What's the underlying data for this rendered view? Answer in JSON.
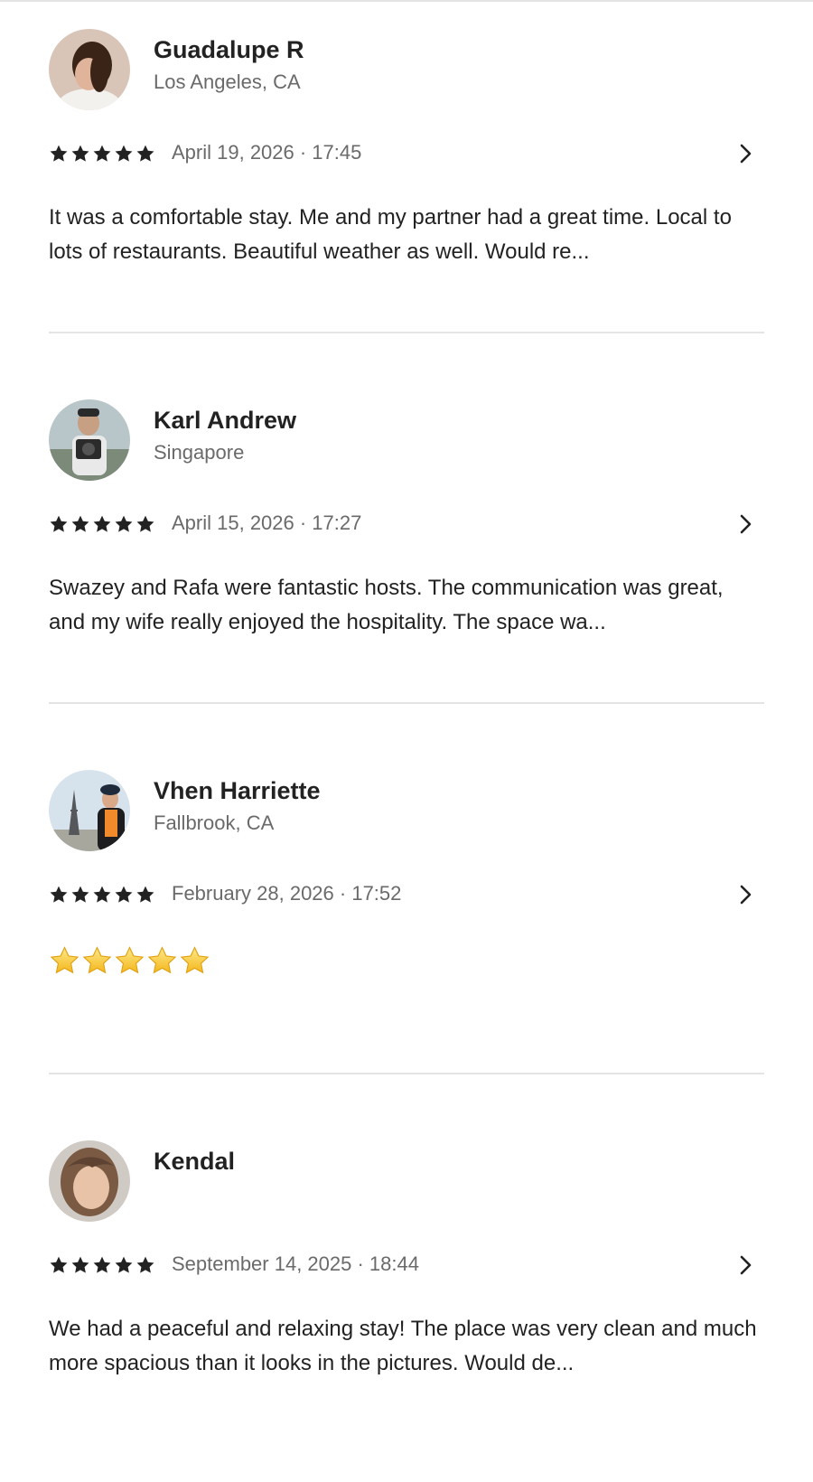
{
  "reviews": [
    {
      "name": "Guadalupe R",
      "location": "Los Angeles, CA",
      "rating": 5,
      "date": "April 19, 2026 · 17:45",
      "text": "It was a comfortable stay. Me and my partner had a great time. Local to lots of restaurants. Beautiful weather as well. Would re..."
    },
    {
      "name": "Karl Andrew",
      "location": "Singapore",
      "rating": 5,
      "date": "April 15, 2026 · 17:27",
      "text": "Swazey and Rafa were fantastic hosts. The communication was great, and my wife really enjoyed the hospitality. The space wa..."
    },
    {
      "name": "Vhen Harriette",
      "location": "Fallbrook, CA",
      "rating": 5,
      "date": "February 28, 2026 · 17:52",
      "text_emoji_stars": 5
    },
    {
      "name": "Kendal",
      "location": "",
      "rating": 5,
      "date": "September 14, 2025 · 18:44",
      "text": "We had a peaceful and relaxing stay! The place was very clean and much more spacious than it looks in the pictures. Would de..."
    }
  ],
  "icons": {
    "rating_star": "star-icon",
    "open_review": "chevron-right-icon",
    "emoji_star": "star-emoji-icon"
  },
  "colors": {
    "text_primary": "#222222",
    "text_secondary": "#6a6a6a",
    "divider": "#e4e4e4",
    "emoji_star": "#f5c518"
  }
}
